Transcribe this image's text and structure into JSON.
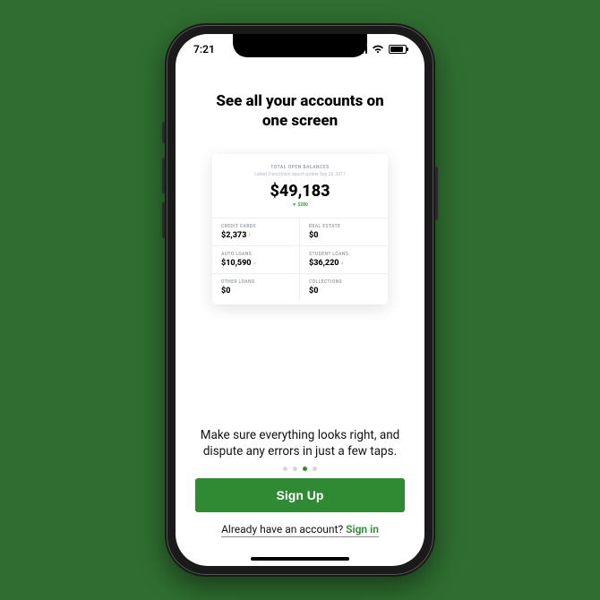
{
  "status": {
    "time": "7:21"
  },
  "page": {
    "title": "See all your accounts on\none screen",
    "subtitle": "Make sure everything looks right, and\ndispute any errors in just a few taps."
  },
  "card": {
    "total_label": "TOTAL OPEN BALANCES",
    "update_text": "Latest TransUnion report update Sep 26, 2017",
    "total_amount": "$49,183",
    "delta": "▼ $280",
    "cells": [
      {
        "label": "CREDIT CARDS",
        "value": "$2,373",
        "arrow": "up"
      },
      {
        "label": "REAL ESTATE",
        "value": "$0",
        "arrow": null
      },
      {
        "label": "AUTO LOANS",
        "value": "$10,590",
        "arrow": "down"
      },
      {
        "label": "STUDENT LOANS",
        "value": "$36,220",
        "arrow": "down"
      },
      {
        "label": "OTHER LOANS",
        "value": "$0",
        "arrow": null
      },
      {
        "label": "COLLECTIONS",
        "value": "$0",
        "arrow": null
      }
    ]
  },
  "pager": {
    "count": 4,
    "active_index": 2
  },
  "cta_label": "Sign Up",
  "signin": {
    "prelude": "Already have an account? ",
    "link_text": "Sign in"
  }
}
